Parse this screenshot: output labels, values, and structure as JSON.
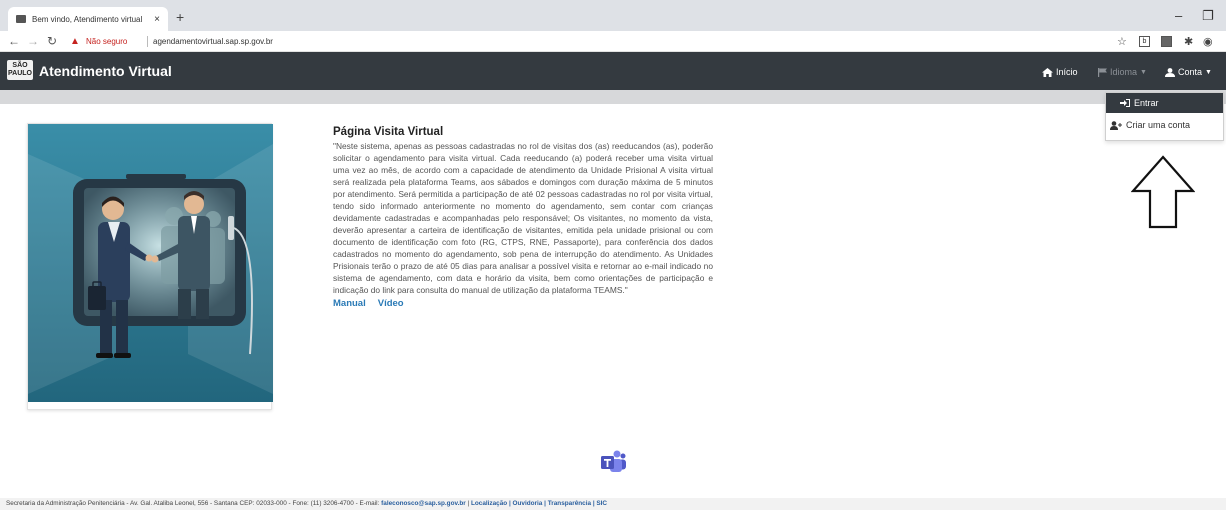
{
  "browser": {
    "tab_title": "Bem vindo, Atendimento virtual",
    "tab_close": "×",
    "new_tab": "+",
    "security_label": "Não seguro",
    "url": "agendamentovirtual.sap.sp.gov.br"
  },
  "navbar": {
    "brand": "Atendimento Virtual",
    "logo_text": "SÃO PAULO",
    "home": "Início",
    "language": "Idioma",
    "account": "Conta"
  },
  "dropdown": {
    "login": "Entrar",
    "create_account": "Criar uma conta"
  },
  "article": {
    "title": "Página Visita Virtual",
    "body": "\"Neste sistema, apenas as pessoas cadastradas no rol de visitas dos (as) reeducandos (as), poderão solicitar o agendamento para visita virtual. Cada reeducando (a) poderá receber uma visita virtual uma vez ao mês, de acordo com a capacidade de atendimento da Unidade Prisional A visita virtual será realizada pela plataforma Teams, aos sábados e domingos com duração máxima de 5 minutos por atendimento. Será permitida a participação de até 02 pessoas cadastradas no rol por visita virtual, tendo sido informado anteriormente no momento do agendamento, sem contar com crianças devidamente cadastradas e acompanhadas pelo responsável; Os visitantes, no momento da vista, deverão apresentar a carteira de identificação de visitantes, emitida pela unidade prisional ou com documento de identificação com foto (RG, CTPS, RNE, Passaporte), para conferência dos dados cadastrados no momento do agendamento, sob pena de interrupção do atendimento. As Unidades Prisionais terão o prazo de até 05 dias para analisar a possível visita e retornar ao e-mail indicado no sistema de agendamento, com data e horário da visita, bem como orientações de participação e indicação do link para consulta do manual de utilização da plataforma TEAMS.\"",
    "link_manual": "Manual",
    "link_video": "Vídeo"
  },
  "footer": {
    "text": "Secretaria da Administração Penitenciária - Av. Gal. Ataliba Leonel, 556 - Santana CEP: 02033-000 - Fone: (11) 3206-4700 - E-mail: ",
    "email": "faleconosco@sap.sp.gov.br",
    "links": "Localização | Ouvidoria | Transparência | SIC"
  },
  "colors": {
    "navbar": "#343a40",
    "link": "#2a7ab6",
    "illustration_bg": "#2e7f99"
  }
}
